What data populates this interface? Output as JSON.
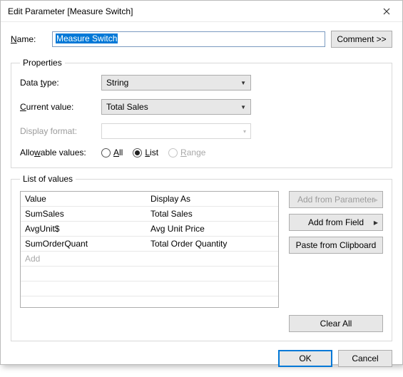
{
  "title": "Edit Parameter [Measure Switch]",
  "name": {
    "label_pre": "N",
    "label_post": "ame:",
    "value": "Measure Switch"
  },
  "comment_label": "Comment >>",
  "properties": {
    "legend": "Properties",
    "data_type": {
      "label_pre": "Data ",
      "label_u": "t",
      "label_post": "ype:",
      "value": "String"
    },
    "current_value": {
      "label_pre": "C",
      "label_post": "urrent value:",
      "value": "Total Sales"
    },
    "display_format": {
      "label": "Display format:"
    },
    "allowable": {
      "label_pre": "Allo",
      "label_u": "w",
      "label_post": "able values:",
      "all": "All",
      "list": "List",
      "range": "Range",
      "selected": "List"
    }
  },
  "list": {
    "legend": "List of values",
    "headers": {
      "value": "Value",
      "display": "Display As"
    },
    "rows": [
      {
        "value": "SumSales",
        "display": "Total Sales"
      },
      {
        "value": "AvgUnit$",
        "display": "Avg Unit Price"
      },
      {
        "value": "SumOrderQuant",
        "display": "Total Order Quantity"
      }
    ],
    "add_label": "Add",
    "buttons": {
      "add_param": "Add from Parameter",
      "add_field": "Add from Field",
      "paste": "Paste from Clipboard",
      "clear": "Clear All"
    }
  },
  "footer": {
    "ok": "OK",
    "cancel": "Cancel"
  }
}
